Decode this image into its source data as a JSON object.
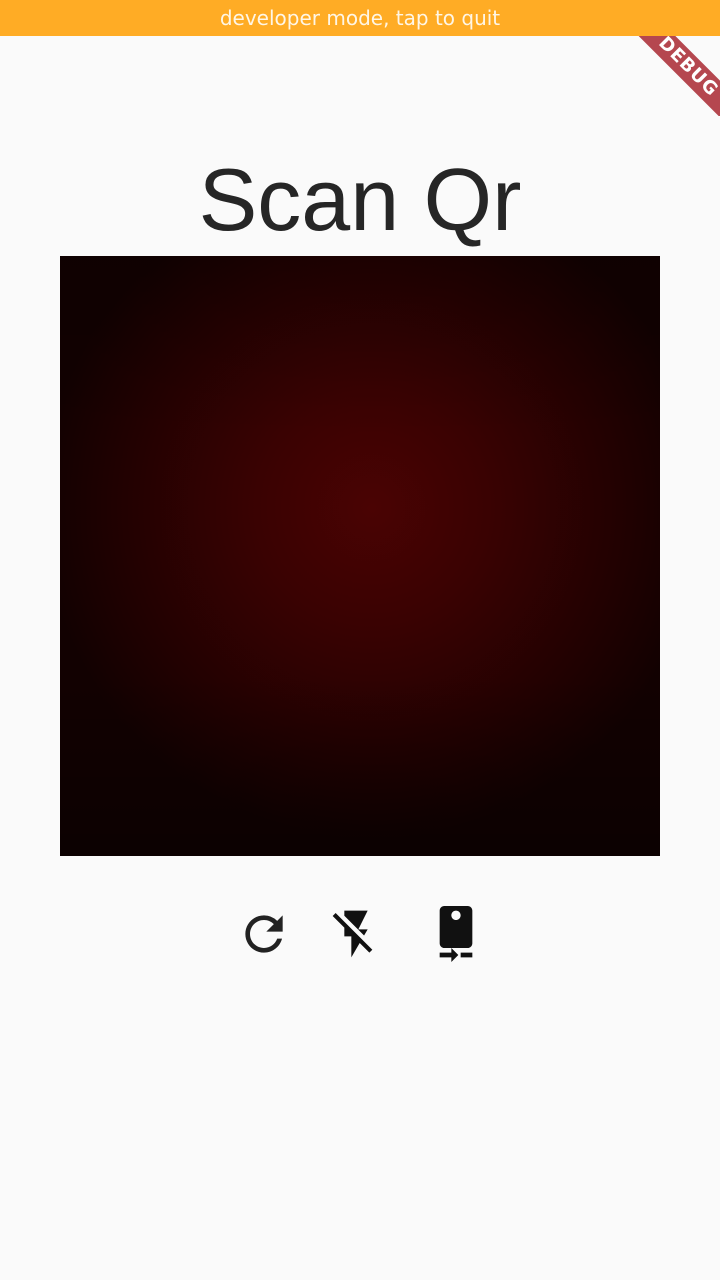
{
  "dev_banner": {
    "text": "developer mode, tap to quit",
    "background": "#ffac25"
  },
  "debug_ribbon": {
    "text": "DEBUG",
    "color": "#b5474f"
  },
  "page": {
    "title": "Scan Qr",
    "background": "#fafafa"
  },
  "camera_preview": {
    "state": "live camera feed"
  },
  "controls": [
    {
      "icon": "refresh-icon"
    },
    {
      "icon": "flash-off-icon"
    },
    {
      "icon": "switch-camera-icon"
    }
  ]
}
